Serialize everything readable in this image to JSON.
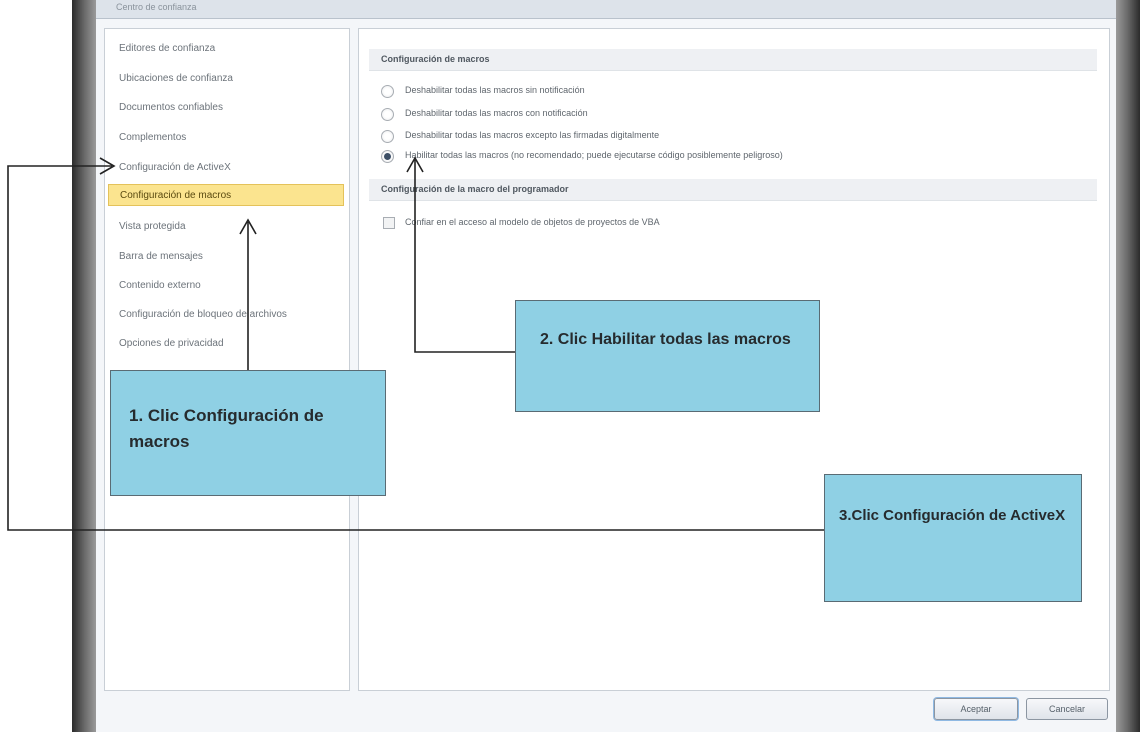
{
  "window": {
    "title": "Centro de confianza"
  },
  "nav": {
    "items": [
      {
        "label": "Editores de confianza",
        "selected": false
      },
      {
        "label": "Ubicaciones de confianza",
        "selected": false
      },
      {
        "label": "Documentos confiables",
        "selected": false
      },
      {
        "label": "Complementos",
        "selected": false
      },
      {
        "label": "Configuración de ActiveX",
        "selected": false
      },
      {
        "label": "Configuración de macros",
        "selected": true
      },
      {
        "label": "Vista protegida",
        "selected": false
      },
      {
        "label": "Barra de mensajes",
        "selected": false
      },
      {
        "label": "Contenido externo",
        "selected": false
      },
      {
        "label": "Configuración de bloqueo de archivos",
        "selected": false
      },
      {
        "label": "Opciones de privacidad",
        "selected": false
      }
    ]
  },
  "macros": {
    "section_title": "Configuración de macros",
    "options": [
      {
        "label": "Deshabilitar todas las macros sin notificación",
        "selected": false
      },
      {
        "label": "Deshabilitar todas las macros con notificación",
        "selected": false
      },
      {
        "label": "Deshabilitar todas las macros excepto las firmadas digitalmente",
        "selected": false
      },
      {
        "label": "Habilitar todas las macros (no recomendado; puede ejecutarse código posiblemente peligroso)",
        "selected": true
      }
    ]
  },
  "developer": {
    "section_title": "Configuración de la macro del programador",
    "checkbox_label": "Confiar en el acceso al modelo de objetos de proyectos de VBA",
    "checked": false
  },
  "buttons": {
    "accept": "Aceptar",
    "cancel": "Cancelar"
  },
  "callouts": {
    "step1": "1. Clic Configuración de macros",
    "step2": "2. Clic Habilitar todas las macros",
    "step3": "3.Clic Configuración de ActiveX"
  },
  "colors": {
    "callout_fill": "#8fd0e4",
    "selected_nav": "#fbe48f"
  }
}
